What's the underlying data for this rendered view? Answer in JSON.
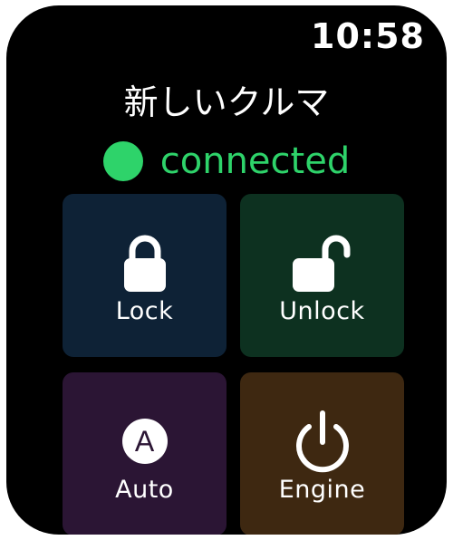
{
  "status_bar": {
    "time": "10:58"
  },
  "header": {
    "title": "新しいクルマ"
  },
  "connection": {
    "status_text": "connected",
    "status_color": "#2ed36a",
    "indicator_icon": "green-dot-icon"
  },
  "controls": {
    "lock": {
      "label": "Lock",
      "icon": "lock-closed-icon",
      "color": "#0e2236"
    },
    "unlock": {
      "label": "Unlock",
      "icon": "lock-open-icon",
      "color": "#0d3120"
    },
    "auto": {
      "label": "Auto",
      "icon_letter": "A",
      "icon": "auto-circle-icon",
      "color": "#2b1534"
    },
    "engine": {
      "label": "Engine",
      "icon": "power-icon",
      "color": "#3e2811"
    }
  }
}
